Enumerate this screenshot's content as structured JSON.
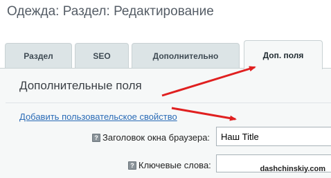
{
  "header": {
    "title": "Одежда: Раздел: Редактирование"
  },
  "tabs": [
    {
      "label": "Раздел",
      "active": false
    },
    {
      "label": "SEO",
      "active": false
    },
    {
      "label": "Дополнительно",
      "active": false
    },
    {
      "label": "Доп. поля",
      "active": true
    }
  ],
  "panel": {
    "heading": "Дополнительные поля",
    "add_property_link": "Добавить пользовательское свойство",
    "fields": [
      {
        "help_icon": "question-icon",
        "label": "Заголовок окна браузера:",
        "value": "Наш Title"
      },
      {
        "help_icon": "question-icon",
        "label": "Ключевые слова:",
        "value": ""
      }
    ]
  },
  "annotation": {
    "arrow_color": "#e02020"
  },
  "watermark": "dashchinskiy.com"
}
